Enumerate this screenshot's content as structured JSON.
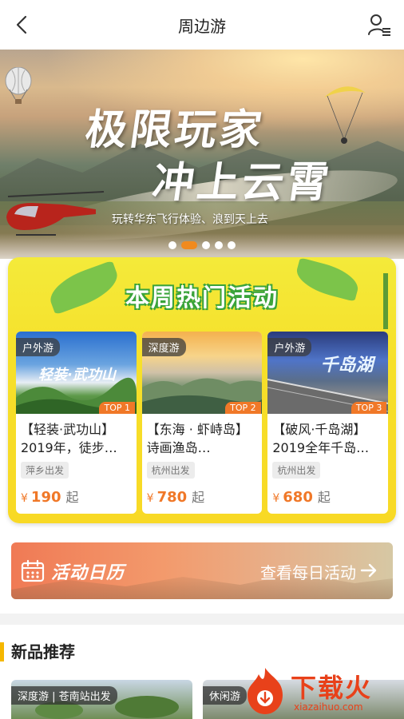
{
  "header": {
    "title": "周边游"
  },
  "banner": {
    "headline_line1": "极限玩家",
    "headline_line2": "冲上云霄",
    "subline": "玩转华东飞行体验、浪到天上去",
    "dots_count": 5,
    "active_dot": 2
  },
  "hot": {
    "title": "本周热门活动",
    "cards": [
      {
        "tag": "户外游",
        "rank": "TOP 1",
        "image_text": "轻装·武功山",
        "name": "【轻装·武功山】2019年，徒步…",
        "depart": "萍乡出发",
        "yen": "¥",
        "price": "190",
        "from": "起"
      },
      {
        "tag": "深度游",
        "rank": "TOP 2",
        "image_text": "",
        "name": "【东海 · 虾峙岛】诗画渔岛…",
        "depart": "杭州出发",
        "yen": "¥",
        "price": "780",
        "from": "起"
      },
      {
        "tag": "户外游",
        "rank": "TOP 3",
        "image_text": "千岛湖",
        "name": "【破风·千岛湖】2019全年千岛…",
        "depart": "杭州出发",
        "yen": "¥",
        "price": "680",
        "from": "起"
      }
    ]
  },
  "calendar": {
    "title": "活动日历",
    "link": "查看每日活动"
  },
  "new": {
    "title": "新品推荐",
    "items": [
      {
        "tag": "深度游 | 苍南站出发"
      },
      {
        "tag": "休闲游"
      }
    ]
  },
  "watermark": {
    "text": "下载火",
    "sub": "xiazaihuo.com"
  },
  "colors": {
    "accent": "#f07828",
    "hot_bg": "#f6e02a",
    "green": "#3aa33a",
    "new_bar": "#f5b700"
  }
}
